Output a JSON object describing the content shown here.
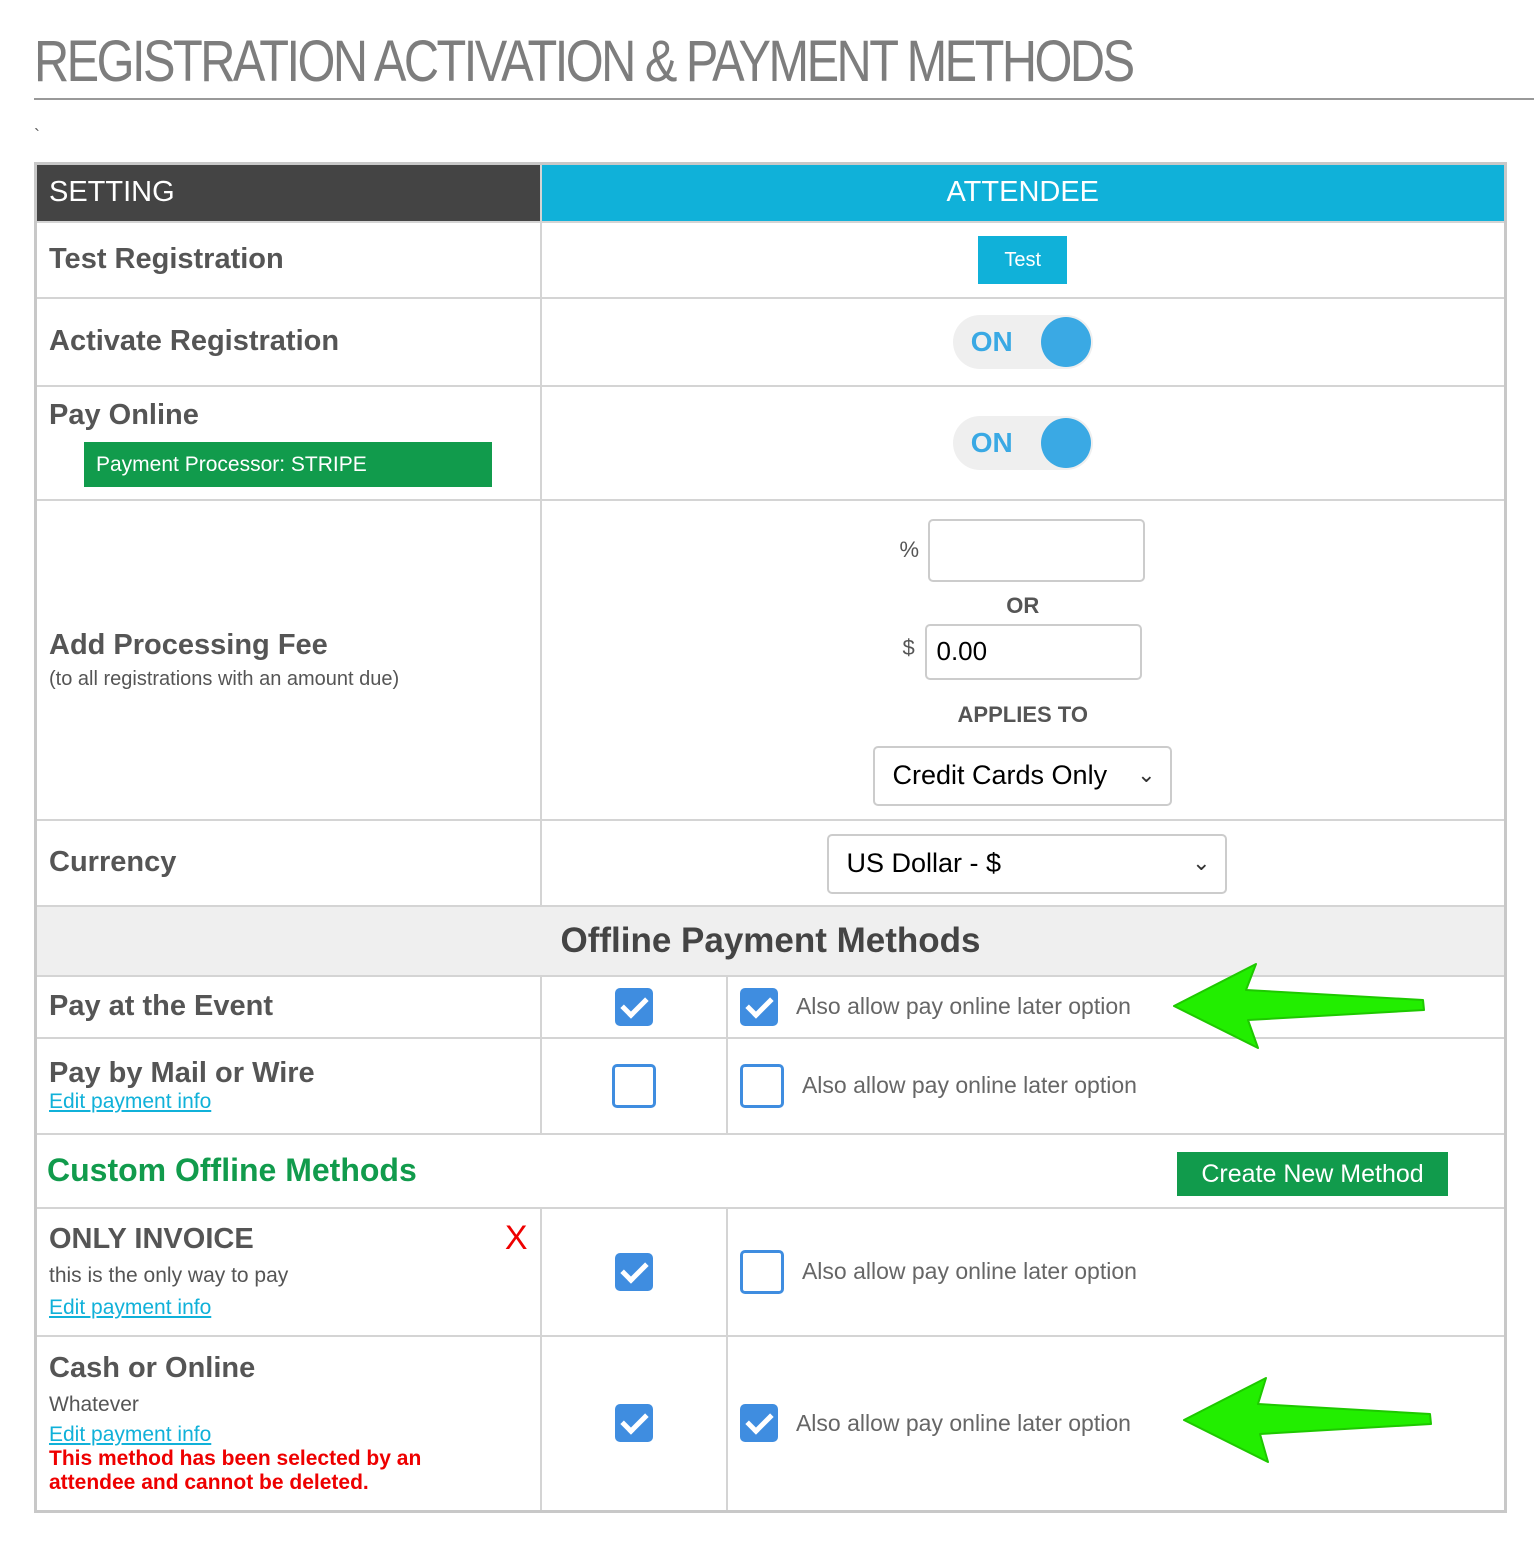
{
  "page": {
    "title": "REGISTRATION ACTIVATION & PAYMENT METHODS",
    "stray_mark": "`"
  },
  "table_header": {
    "setting": "SETTING",
    "attendee": "ATTENDEE"
  },
  "test_registration": {
    "label": "Test Registration",
    "button_label": "Test"
  },
  "activate_registration": {
    "label": "Activate Registration",
    "toggle_state": "ON"
  },
  "pay_online": {
    "label": "Pay Online",
    "processor_badge": "Payment Processor: STRIPE",
    "toggle_state": "ON"
  },
  "processing_fee": {
    "label": "Add Processing Fee",
    "subnote": "(to all registrations with an amount due)",
    "percent_symbol": "%",
    "percent_value": "",
    "or_text": "OR",
    "dollar_symbol": "$",
    "dollar_value": "0.00",
    "applies_to_label": "APPLIES TO",
    "applies_to_selected": "Credit Cards Only"
  },
  "currency": {
    "label": "Currency",
    "selected": "US Dollar - $"
  },
  "offline_section": {
    "title": "Offline Payment Methods"
  },
  "offline_methods": [
    {
      "label": "Pay at the Event",
      "enabled": true,
      "also_allow_checked": true,
      "also_allow_label": "Also allow pay online later option"
    },
    {
      "label": "Pay by Mail or Wire",
      "edit_link": "Edit payment info",
      "enabled": false,
      "also_allow_checked": false,
      "also_allow_label": "Also allow pay online later option"
    }
  ],
  "custom_section": {
    "title": "Custom Offline Methods",
    "create_button": "Create New Method"
  },
  "custom_methods": [
    {
      "label": "ONLY INVOICE",
      "description": "this is the only way to pay",
      "edit_link": "Edit payment info",
      "delete_label": "X",
      "enabled": true,
      "also_allow_checked": false,
      "also_allow_label": "Also allow pay online later option"
    },
    {
      "label": "Cash or Online",
      "description": "Whatever",
      "edit_link": "Edit payment info",
      "warning": "This method has been selected by an attendee and cannot be deleted.",
      "enabled": true,
      "also_allow_checked": true,
      "also_allow_label": "Also allow pay online later option"
    }
  ],
  "colors": {
    "accent_blue": "#10b1d9",
    "toggle_blue": "#3aa9e4",
    "checkbox_blue": "#3f8de0",
    "brand_green": "#119b4c",
    "header_dark": "#444444",
    "warning_red": "#ee0000",
    "annotation_arrow": "#22ee00"
  }
}
